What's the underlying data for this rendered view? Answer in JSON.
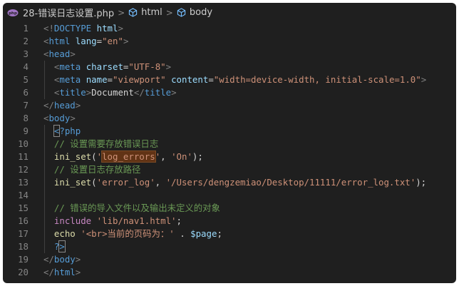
{
  "breadcrumb": {
    "file": "28-错误日志设置.php",
    "items": [
      "html",
      "body"
    ],
    "separator": ">"
  },
  "lines": [
    {
      "n": "1",
      "tokens": [
        [
          "t-punc",
          "<!"
        ],
        [
          "t-tag",
          "DOCTYPE"
        ],
        [
          "t-text",
          " "
        ],
        [
          "t-attr",
          "html"
        ],
        [
          "t-punc",
          ">"
        ]
      ]
    },
    {
      "n": "2",
      "tokens": [
        [
          "t-punc",
          "<"
        ],
        [
          "t-tag",
          "html"
        ],
        [
          "t-text",
          " "
        ],
        [
          "t-attr",
          "lang"
        ],
        [
          "t-text",
          "="
        ],
        [
          "t-str",
          "\"en\""
        ],
        [
          "t-punc",
          ">"
        ]
      ]
    },
    {
      "n": "3",
      "tokens": [
        [
          "t-punc",
          "<"
        ],
        [
          "t-tag",
          "head"
        ],
        [
          "t-punc",
          ">"
        ]
      ]
    },
    {
      "n": "4",
      "tokens": [
        [
          "t-text",
          "  "
        ],
        [
          "t-punc",
          "<"
        ],
        [
          "t-tag",
          "meta"
        ],
        [
          "t-text",
          " "
        ],
        [
          "t-attr",
          "charset"
        ],
        [
          "t-text",
          "="
        ],
        [
          "t-str",
          "\"UTF-8\""
        ],
        [
          "t-punc",
          ">"
        ]
      ]
    },
    {
      "n": "5",
      "tokens": [
        [
          "t-text",
          "  "
        ],
        [
          "t-punc",
          "<"
        ],
        [
          "t-tag",
          "meta"
        ],
        [
          "t-text",
          " "
        ],
        [
          "t-attr",
          "name"
        ],
        [
          "t-text",
          "="
        ],
        [
          "t-str",
          "\"viewport\""
        ],
        [
          "t-text",
          " "
        ],
        [
          "t-attr",
          "content"
        ],
        [
          "t-text",
          "="
        ],
        [
          "t-str",
          "\"width=device-width, initial-scale=1.0\""
        ],
        [
          "t-punc",
          ">"
        ]
      ]
    },
    {
      "n": "6",
      "tokens": [
        [
          "t-text",
          "  "
        ],
        [
          "t-punc",
          "<"
        ],
        [
          "t-tag",
          "title"
        ],
        [
          "t-punc",
          ">"
        ],
        [
          "t-text",
          "Document"
        ],
        [
          "t-punc",
          "</"
        ],
        [
          "t-tag",
          "title"
        ],
        [
          "t-punc",
          ">"
        ]
      ]
    },
    {
      "n": "7",
      "tokens": [
        [
          "t-punc",
          "</"
        ],
        [
          "t-tag",
          "head"
        ],
        [
          "t-punc",
          ">"
        ]
      ]
    },
    {
      "n": "8",
      "tokens": [
        [
          "t-punc",
          "<"
        ],
        [
          "t-tag",
          "body"
        ],
        [
          "t-punc",
          ">"
        ]
      ]
    },
    {
      "n": "9",
      "tokens": [
        [
          "t-text",
          "  "
        ],
        [
          "t-php br-box",
          "<"
        ],
        [
          "t-php",
          "?php"
        ]
      ]
    },
    {
      "n": "10",
      "tokens": [
        [
          "t-text",
          "  "
        ],
        [
          "t-cm",
          "// 设置需要存放错误日志"
        ]
      ]
    },
    {
      "n": "11",
      "tokens": [
        [
          "t-text",
          "  "
        ],
        [
          "t-fn",
          "ini_set"
        ],
        [
          "t-plain",
          "("
        ],
        [
          "t-str",
          "'"
        ],
        [
          "t-str hl-box",
          "log_errors"
        ],
        [
          "t-str",
          "'"
        ],
        [
          "t-plain",
          ", "
        ],
        [
          "t-str",
          "'On'"
        ],
        [
          "t-plain",
          ");"
        ]
      ]
    },
    {
      "n": "12",
      "tokens": [
        [
          "t-text",
          "  "
        ],
        [
          "t-cm",
          "// 设置日志存放路径"
        ]
      ]
    },
    {
      "n": "13",
      "tokens": [
        [
          "t-text",
          "  "
        ],
        [
          "t-fn",
          "ini_set"
        ],
        [
          "t-plain",
          "("
        ],
        [
          "t-str",
          "'error_log'"
        ],
        [
          "t-plain",
          ", "
        ],
        [
          "t-str",
          "'/Users/dengzemiao/Desktop/11111/error_log.txt'"
        ],
        [
          "t-plain",
          ");"
        ]
      ]
    },
    {
      "n": "14",
      "tokens": []
    },
    {
      "n": "15",
      "tokens": [
        [
          "t-text",
          "  "
        ],
        [
          "t-cm",
          "// 错误的导入文件以及输出未定义的对象"
        ]
      ]
    },
    {
      "n": "16",
      "tokens": [
        [
          "t-text",
          "  "
        ],
        [
          "t-kw",
          "include"
        ],
        [
          "t-text",
          " "
        ],
        [
          "t-str",
          "'lib/nav1.html'"
        ],
        [
          "t-plain",
          ";"
        ]
      ]
    },
    {
      "n": "17",
      "tokens": [
        [
          "t-text",
          "  "
        ],
        [
          "t-fn",
          "echo"
        ],
        [
          "t-text",
          " "
        ],
        [
          "t-str",
          "'<br>当前的页码为：'"
        ],
        [
          "t-text",
          " "
        ],
        [
          "t-plain",
          "."
        ],
        [
          "t-text",
          " "
        ],
        [
          "t-var",
          "$page"
        ],
        [
          "t-plain",
          ";"
        ]
      ]
    },
    {
      "n": "18",
      "tokens": [
        [
          "t-text",
          "  "
        ],
        [
          "t-php",
          "?"
        ],
        [
          "t-php br-box",
          ">"
        ]
      ]
    },
    {
      "n": "19",
      "tokens": [
        [
          "t-punc",
          "</"
        ],
        [
          "t-tag",
          "body"
        ],
        [
          "t-punc",
          ">"
        ]
      ]
    },
    {
      "n": "20",
      "tokens": [
        [
          "t-punc",
          "</"
        ],
        [
          "t-tag",
          "html"
        ],
        [
          "t-punc",
          ">"
        ]
      ]
    }
  ]
}
